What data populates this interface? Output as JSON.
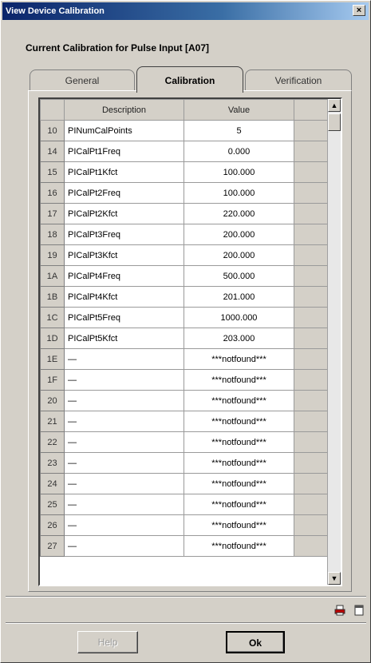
{
  "window": {
    "title": "View Device Calibration",
    "close_label": "×"
  },
  "heading": "Current Calibration for Pulse Input [A07]",
  "tabs": [
    {
      "label": "General",
      "active": false
    },
    {
      "label": "Calibration",
      "active": true
    },
    {
      "label": "Verification",
      "active": false
    }
  ],
  "table": {
    "columns": [
      "Description",
      "Value"
    ],
    "rows": [
      {
        "id": "10",
        "description": "PINumCalPoints",
        "value": "5"
      },
      {
        "id": "14",
        "description": "PICalPt1Freq",
        "value": "0.000"
      },
      {
        "id": "15",
        "description": "PICalPt1Kfct",
        "value": "100.000"
      },
      {
        "id": "16",
        "description": "PICalPt2Freq",
        "value": "100.000"
      },
      {
        "id": "17",
        "description": "PICalPt2Kfct",
        "value": "220.000"
      },
      {
        "id": "18",
        "description": "PICalPt3Freq",
        "value": "200.000"
      },
      {
        "id": "19",
        "description": "PICalPt3Kfct",
        "value": "200.000"
      },
      {
        "id": "1A",
        "description": "PICalPt4Freq",
        "value": "500.000"
      },
      {
        "id": "1B",
        "description": "PICalPt4Kfct",
        "value": "201.000"
      },
      {
        "id": "1C",
        "description": "PICalPt5Freq",
        "value": "1000.000"
      },
      {
        "id": "1D",
        "description": "PICalPt5Kfct",
        "value": "203.000"
      },
      {
        "id": "1E",
        "description": "—",
        "value": "***notfound***"
      },
      {
        "id": "1F",
        "description": "—",
        "value": "***notfound***"
      },
      {
        "id": "20",
        "description": "—",
        "value": "***notfound***"
      },
      {
        "id": "21",
        "description": "—",
        "value": "***notfound***"
      },
      {
        "id": "22",
        "description": "—",
        "value": "***notfound***"
      },
      {
        "id": "23",
        "description": "—",
        "value": "***notfound***"
      },
      {
        "id": "24",
        "description": "—",
        "value": "***notfound***"
      },
      {
        "id": "25",
        "description": "—",
        "value": "***notfound***"
      },
      {
        "id": "26",
        "description": "—",
        "value": "***notfound***"
      },
      {
        "id": "27",
        "description": "—",
        "value": "***notfound***"
      }
    ]
  },
  "scrollbar": {
    "up_arrow": "▲",
    "down_arrow": "▼"
  },
  "icons": [
    "print-icon",
    "page-icon"
  ],
  "buttons": {
    "help_label": "Help",
    "ok_label": "Ok"
  }
}
